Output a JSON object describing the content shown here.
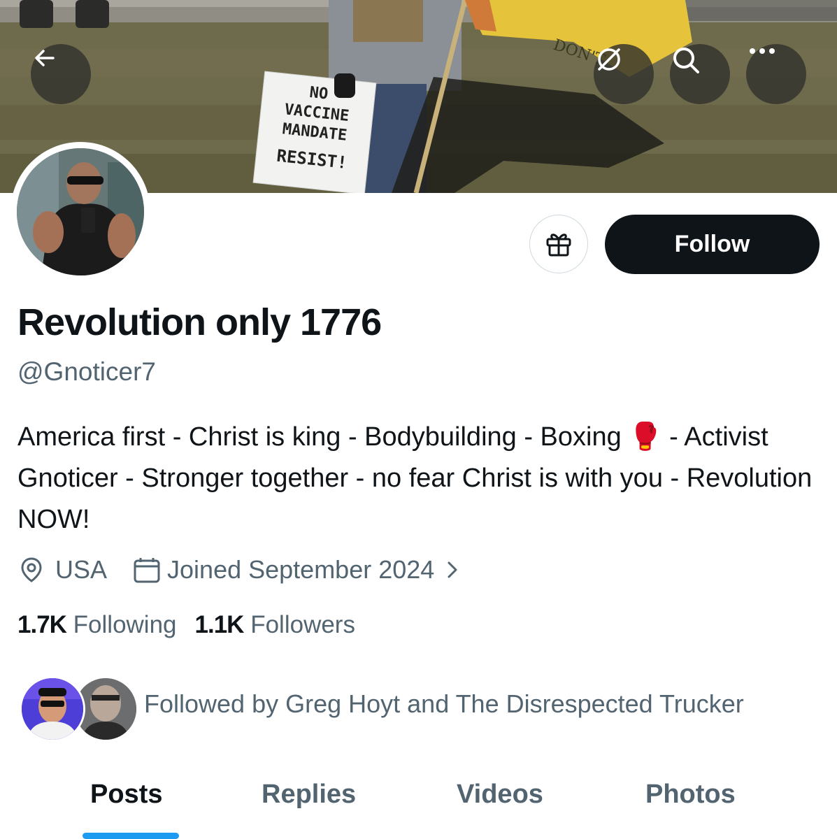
{
  "header": {
    "back_icon": "arrow-left-icon",
    "grok_icon": "grok-icon",
    "search_icon": "search-icon",
    "more_icon": "more-icon"
  },
  "banner": {
    "sign_text": [
      "NO",
      "VACCINE",
      "MANDATE",
      "RESIST!"
    ],
    "flag_text": "DON'T"
  },
  "profile": {
    "display_name": "Revolution only 1776",
    "handle": "@Gnoticer7",
    "bio": "America first - Christ is king - Bodybuilding - Boxing 🥊 - Activist Gnoticer - Stronger together - no fear Christ is with you - Revolution NOW!",
    "location": "USA",
    "joined": "Joined September 2024",
    "following_count": "1.7K",
    "following_label": "Following",
    "followers_count": "1.1K",
    "followers_label": "Followers",
    "followed_by": "Followed by Greg Hoyt and The Disrespected Trucker"
  },
  "actions": {
    "gift_icon": "gift-icon",
    "follow_label": "Follow"
  },
  "tabs": [
    {
      "label": "Posts",
      "active": true
    },
    {
      "label": "Replies",
      "active": false
    },
    {
      "label": "Videos",
      "active": false
    },
    {
      "label": "Photos",
      "active": false
    }
  ],
  "colors": {
    "accent": "#1d9bf0",
    "text_primary": "#0f1419",
    "text_secondary": "#536471",
    "follow_bg": "#0f1419"
  }
}
